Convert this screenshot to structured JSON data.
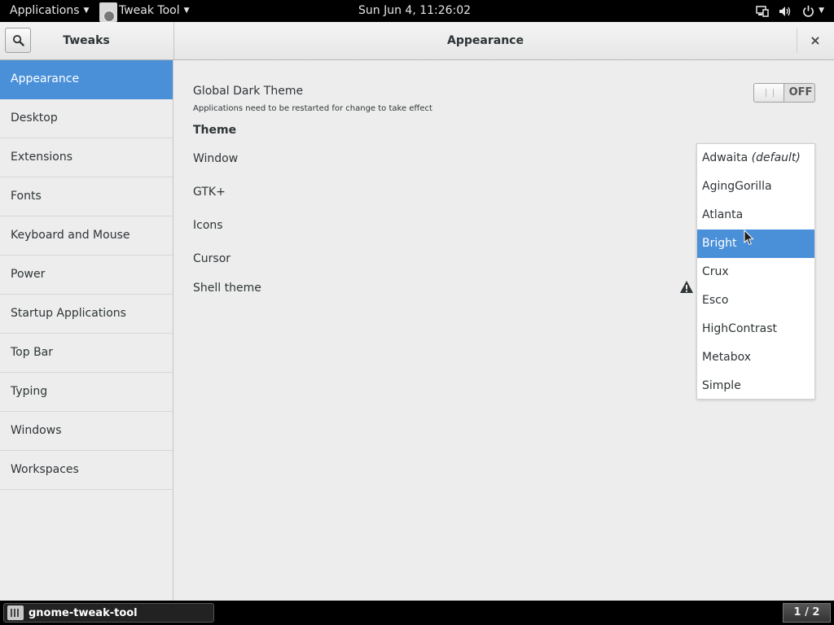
{
  "topbar": {
    "applications_label": "Applications",
    "app_menu_label": "Tweak Tool",
    "clock": "Sun Jun  4, 11:26:02",
    "status_icons": [
      "network-icon",
      "volume-icon",
      "power-icon"
    ]
  },
  "window": {
    "sidebar_title": "Tweaks",
    "page_title": "Appearance",
    "close_glyph": "×"
  },
  "sidebar": {
    "items": [
      {
        "label": "Appearance",
        "selected": true
      },
      {
        "label": "Desktop"
      },
      {
        "label": "Extensions"
      },
      {
        "label": "Fonts"
      },
      {
        "label": "Keyboard and Mouse"
      },
      {
        "label": "Power"
      },
      {
        "label": "Startup Applications"
      },
      {
        "label": "Top Bar"
      },
      {
        "label": "Typing"
      },
      {
        "label": "Windows"
      },
      {
        "label": "Workspaces"
      }
    ]
  },
  "appearance": {
    "dark_theme_label": "Global Dark Theme",
    "dark_theme_note": "Applications need to be restarted for change to take effect",
    "dark_theme_state": "OFF",
    "theme_heading": "Theme",
    "rows": {
      "window": "Window",
      "gtk": "GTK+",
      "icons": "Icons",
      "cursor": "Cursor",
      "shell": "Shell theme"
    }
  },
  "theme_popup": {
    "default_suffix": "(default)",
    "items": [
      "Adwaita",
      "AgingGorilla",
      "Atlanta",
      "Bright",
      "Crux",
      "Esco",
      "HighContrast",
      "Metabox",
      "Simple"
    ],
    "highlighted": "Bright"
  },
  "bottombar": {
    "task_label": "gnome-tweak-tool",
    "workspace": "1 / 2"
  },
  "colors": {
    "accent": "#4a90d9",
    "panel": "#000000",
    "window_bg": "#ededed"
  }
}
